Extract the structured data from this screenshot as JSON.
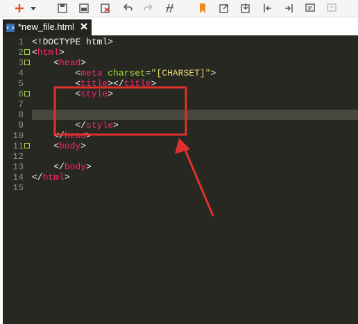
{
  "toolbar": {
    "buttons": [
      {
        "name": "add-new-icon"
      },
      {
        "name": "dropdown-arrow-icon"
      },
      {
        "name": "save-icon"
      },
      {
        "name": "save-all-icon"
      },
      {
        "name": "close-file-icon"
      },
      {
        "name": "undo-icon"
      },
      {
        "name": "redo-icon"
      },
      {
        "name": "format-icon"
      },
      {
        "name": "bookmark-icon"
      },
      {
        "name": "goto-icon"
      },
      {
        "name": "export-icon"
      },
      {
        "name": "indent-left-icon"
      },
      {
        "name": "indent-right-icon"
      },
      {
        "name": "comment-icon"
      },
      {
        "name": "uncomment-icon"
      }
    ]
  },
  "tab": {
    "label": "*new_file.html",
    "icon": "html-file-icon",
    "close_icon": "close-icon"
  },
  "editor": {
    "current_line": 8,
    "lines": [
      {
        "n": "1",
        "tokens": [
          [
            "plain",
            "<!DOCTYPE html>"
          ]
        ]
      },
      {
        "n": "2",
        "tokens": [
          [
            "plain",
            "<"
          ],
          [
            "tag",
            "html"
          ],
          [
            "plain",
            ">"
          ]
        ]
      },
      {
        "n": "3",
        "tokens": [
          [
            "plain",
            "    <"
          ],
          [
            "tag",
            "head"
          ],
          [
            "plain",
            ">"
          ]
        ]
      },
      {
        "n": "4",
        "tokens": [
          [
            "plain",
            "        <"
          ],
          [
            "tag",
            "meta"
          ],
          [
            "plain",
            " "
          ],
          [
            "attr",
            "charset"
          ],
          [
            "plain",
            "="
          ],
          [
            "str",
            "\"[CHARSET]\""
          ],
          [
            "plain",
            ">"
          ]
        ]
      },
      {
        "n": "5",
        "tokens": [
          [
            "plain",
            "        <"
          ],
          [
            "tag",
            "title"
          ],
          [
            "plain",
            "></"
          ],
          [
            "tag",
            "title"
          ],
          [
            "plain",
            ">"
          ]
        ]
      },
      {
        "n": "6",
        "tokens": [
          [
            "plain",
            "        <"
          ],
          [
            "tag",
            "style"
          ],
          [
            "plain",
            ">"
          ]
        ]
      },
      {
        "n": "7",
        "tokens": [
          [
            "plain",
            ""
          ]
        ]
      },
      {
        "n": "8",
        "tokens": [
          [
            "plain",
            ""
          ]
        ]
      },
      {
        "n": "9",
        "tokens": [
          [
            "plain",
            "        </"
          ],
          [
            "tag",
            "style"
          ],
          [
            "plain",
            ">"
          ]
        ]
      },
      {
        "n": "10",
        "tokens": [
          [
            "plain",
            "    </"
          ],
          [
            "tag",
            "head"
          ],
          [
            "plain",
            ">"
          ]
        ]
      },
      {
        "n": "11",
        "tokens": [
          [
            "plain",
            "    <"
          ],
          [
            "tag",
            "body"
          ],
          [
            "plain",
            ">"
          ]
        ]
      },
      {
        "n": "12",
        "tokens": [
          [
            "plain",
            ""
          ]
        ]
      },
      {
        "n": "13",
        "tokens": [
          [
            "plain",
            "    </"
          ],
          [
            "tag",
            "body"
          ],
          [
            "plain",
            ">"
          ]
        ]
      },
      {
        "n": "14",
        "tokens": [
          [
            "plain",
            "</"
          ],
          [
            "tag",
            "html"
          ],
          [
            "plain",
            ">"
          ]
        ]
      },
      {
        "n": "15",
        "tokens": [
          [
            "plain",
            ""
          ]
        ]
      }
    ],
    "fold_lines": [
      "2",
      "3",
      "6",
      "11"
    ]
  },
  "colors": {
    "editor_bg": "#272822",
    "tag": "#f92672",
    "attr": "#a6e22e",
    "string": "#e6db74",
    "annotation": "#e0312f"
  }
}
